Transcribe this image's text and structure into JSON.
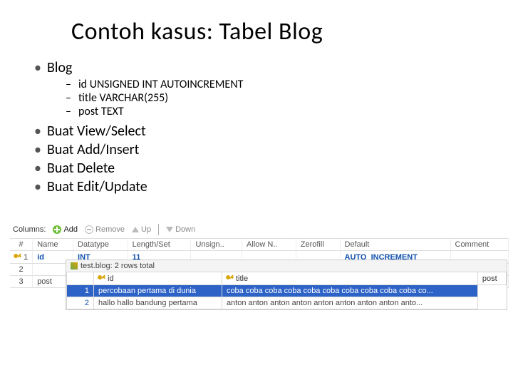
{
  "title": "Contoh kasus: Tabel Blog",
  "bullets": {
    "top1": "Blog",
    "sub": [
      "id UNSIGNED INT AUTOINCREMENT",
      "title VARCHAR(255)",
      "post TEXT"
    ],
    "more": [
      "Buat View/Select",
      "Buat Add/Insert",
      "Buat Delete",
      "Buat Edit/Update"
    ]
  },
  "toolbar": {
    "columns": "Columns:",
    "add": "Add",
    "remove": "Remove",
    "up": "Up",
    "down": "Down"
  },
  "cols_header": [
    "#",
    "Name",
    "Datatype",
    "Length/Set",
    "Unsign..",
    "Allow N..",
    "Zerofill",
    "Default",
    "Comment"
  ],
  "cols_rows": [
    {
      "n": "1",
      "name": "id",
      "dt": "INT",
      "len": "11",
      "def": "AUTO_INCREMENT"
    },
    {
      "n": "2",
      "name": ""
    },
    {
      "n": "3",
      "name": "post"
    }
  ],
  "rowwin": {
    "title": "test.blog: 2 rows total"
  },
  "data_header": [
    "",
    "id",
    "title",
    "post"
  ],
  "data_rows": [
    {
      "id": "1",
      "title": "percobaan pertama di dunia",
      "post": "coba coba coba coba coba coba coba coba coba coba co..."
    },
    {
      "id": "2",
      "title": "hallo hallo bandung pertama",
      "post": "anton anton anton anton anton anton anton anton anto..."
    }
  ]
}
